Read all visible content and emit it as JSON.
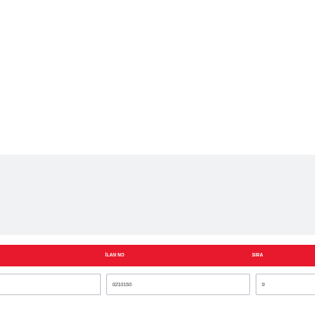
{
  "colors": {
    "header_background": "#e8192c",
    "header_text": "#ffffff",
    "band_background": "#f1f2f4",
    "cell_border": "#c9ccd1"
  },
  "table": {
    "columns": [
      {
        "label": "İLAN NO"
      },
      {
        "label": "SIRA"
      }
    ],
    "rows": [
      {
        "ilan_no": "0210150",
        "sira": "9"
      }
    ]
  }
}
